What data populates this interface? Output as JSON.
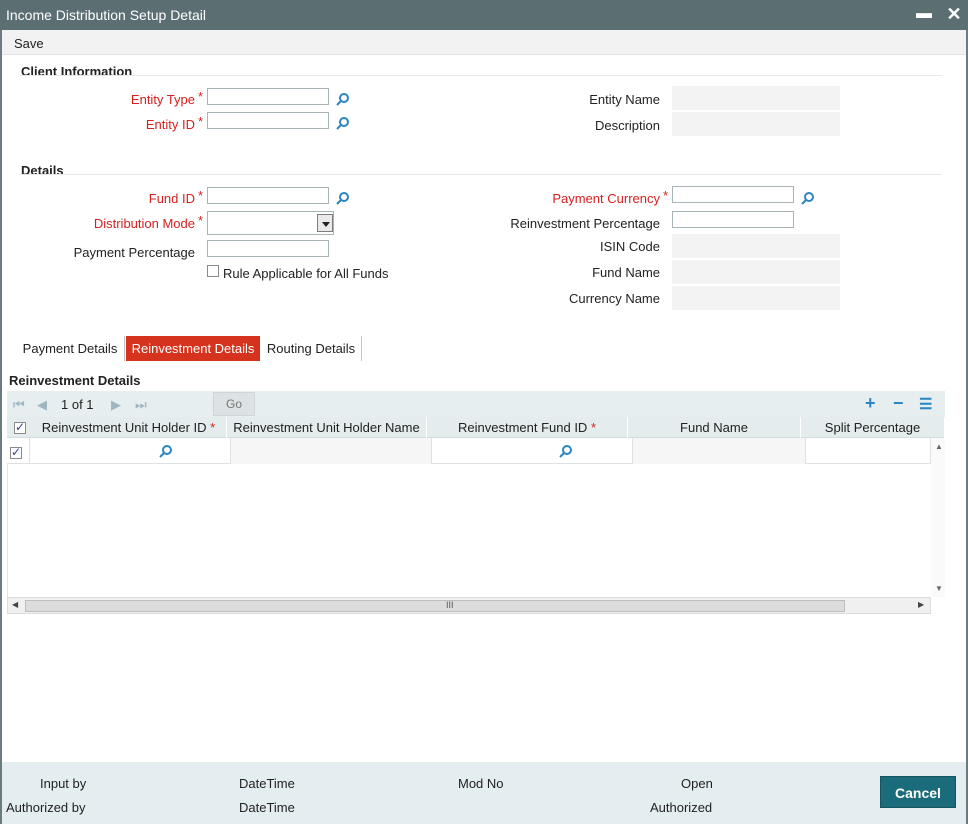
{
  "window": {
    "title": "Income Distribution Setup Detail",
    "minimize": "▬",
    "close": "✕"
  },
  "menu": {
    "save": "Save"
  },
  "client_info": {
    "title": "Client Information",
    "entity_type_label": "Entity Type",
    "entity_id_label": "Entity ID",
    "entity_name_label": "Entity Name",
    "description_label": "Description",
    "required_mark": "*"
  },
  "details": {
    "title": "Details",
    "fund_id_label": "Fund ID",
    "distribution_mode_label": "Distribution Mode",
    "payment_percentage_label": "Payment Percentage",
    "rule_applicable_label": "Rule Applicable for All Funds",
    "payment_currency_label": "Payment Currency",
    "reinvestment_percentage_label": "Reinvestment Percentage",
    "isin_code_label": "ISIN Code",
    "fund_name_label": "Fund Name",
    "currency_name_label": "Currency Name"
  },
  "tabs": [
    {
      "label": "Payment Details",
      "active": false
    },
    {
      "label": "Reinvestment Details",
      "active": true
    },
    {
      "label": "Routing Details",
      "active": false
    }
  ],
  "grid": {
    "title": "Reinvestment Details",
    "pager": "1 of 1",
    "go_label": "Go",
    "add_icon": "+",
    "remove_icon": "−",
    "list_icon": "☰",
    "columns": [
      {
        "label": "Reinvestment Unit Holder ID",
        "required": true
      },
      {
        "label": "Reinvestment Unit Holder Name",
        "required": false
      },
      {
        "label": "Reinvestment Fund ID",
        "required": true
      },
      {
        "label": "Fund Name",
        "required": false
      },
      {
        "label": "Split Percentage",
        "required": false
      }
    ],
    "required_mark": "*",
    "scroll_grip": "III"
  },
  "footer": {
    "input_by": "Input by",
    "authorized_by": "Authorized by",
    "datetime1": "DateTime",
    "datetime2": "DateTime",
    "mod_no": "Mod No",
    "open": "Open",
    "authorized": "Authorized",
    "cancel": "Cancel"
  },
  "colors": {
    "title_bar": "#5b6f73",
    "active_tab": "#d6331e",
    "required": "#d62020",
    "cancel_button": "#1b6c7a",
    "lookup_icon": "#2a85c0"
  }
}
